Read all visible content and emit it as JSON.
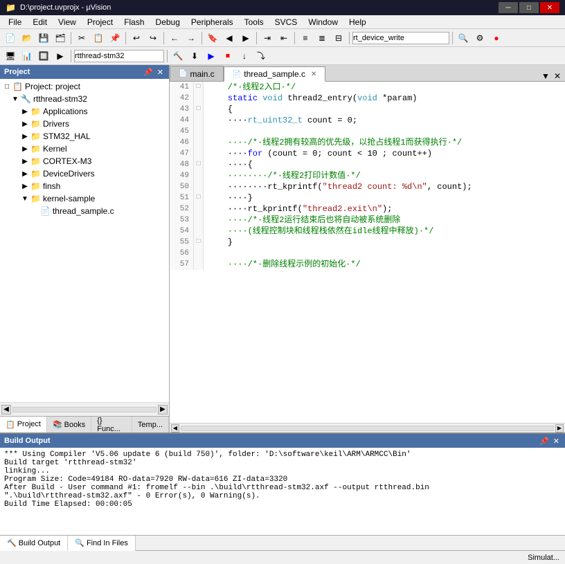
{
  "titleBar": {
    "title": "D:\\project.uvprojx - µVision",
    "icon": "📁",
    "controls": [
      "─",
      "□",
      "✕"
    ]
  },
  "menuBar": {
    "items": [
      "File",
      "Edit",
      "View",
      "Project",
      "Flash",
      "Debug",
      "Peripherals",
      "Tools",
      "SVCS",
      "Window",
      "Help"
    ]
  },
  "toolbar1": {
    "combo_value": "rt_device_write"
  },
  "toolbar2": {
    "combo_value": "rtthread-stm32"
  },
  "leftPanel": {
    "title": "Project",
    "tree": {
      "root": "Project: project",
      "items": [
        {
          "label": "rtthread-stm32",
          "indent": 1,
          "expanded": true,
          "type": "root"
        },
        {
          "label": "Applications",
          "indent": 2,
          "expanded": true,
          "type": "folder"
        },
        {
          "label": "Drivers",
          "indent": 2,
          "expanded": true,
          "type": "folder"
        },
        {
          "label": "STM32_HAL",
          "indent": 2,
          "expanded": true,
          "type": "folder"
        },
        {
          "label": "Kernel",
          "indent": 2,
          "expanded": true,
          "type": "folder"
        },
        {
          "label": "CORTEX-M3",
          "indent": 2,
          "expanded": true,
          "type": "folder"
        },
        {
          "label": "DeviceDrivers",
          "indent": 2,
          "expanded": true,
          "type": "folder"
        },
        {
          "label": "finsh",
          "indent": 2,
          "expanded": true,
          "type": "folder"
        },
        {
          "label": "kernel-sample",
          "indent": 2,
          "expanded": true,
          "type": "folder"
        },
        {
          "label": "thread_sample.c",
          "indent": 3,
          "expanded": false,
          "type": "file"
        }
      ]
    },
    "tabs": [
      {
        "label": "Project",
        "icon": "📋",
        "active": true
      },
      {
        "label": "Books",
        "icon": "📚",
        "active": false
      },
      {
        "label": "{} Func...",
        "icon": "",
        "active": false
      },
      {
        "label": "Temp...",
        "icon": "",
        "active": false
      }
    ]
  },
  "editorTabs": [
    {
      "label": "main.c",
      "icon": "📄",
      "active": false
    },
    {
      "label": "thread_sample.c",
      "icon": "📄",
      "active": true
    }
  ],
  "codeLines": [
    {
      "num": "41",
      "toggle": "□",
      "content": "    /*·线程2入口·*/",
      "type": "comment"
    },
    {
      "num": "42",
      "toggle": " ",
      "content": "    static void thread2_entry(void *param)",
      "type": "code"
    },
    {
      "num": "43",
      "toggle": "□",
      "content": "    {",
      "type": "code"
    },
    {
      "num": "44",
      "toggle": " ",
      "content": "    ····rt_uint32_t count = 0;",
      "type": "code"
    },
    {
      "num": "45",
      "toggle": " ",
      "content": "",
      "type": "code"
    },
    {
      "num": "46",
      "toggle": " ",
      "content": "    ····/*·线程2拥有较高的优先级，以抢占线程1而获得执行·*/",
      "type": "comment"
    },
    {
      "num": "47",
      "toggle": " ",
      "content": "    ····for (count = 0; count < 10 ; count++)",
      "type": "code"
    },
    {
      "num": "48",
      "toggle": "□",
      "content": "    ····{",
      "type": "code"
    },
    {
      "num": "49",
      "toggle": " ",
      "content": "    ········/*·线程2打印计数值·*/",
      "type": "comment"
    },
    {
      "num": "50",
      "toggle": " ",
      "content": "    ········rt_kprintf(\"thread2 count: %d\\n\", count);",
      "type": "code"
    },
    {
      "num": "51",
      "toggle": "□",
      "content": "    ····}",
      "type": "code"
    },
    {
      "num": "52",
      "toggle": " ",
      "content": "    ····rt_kprintf(\"thread2.exit\\n\");",
      "type": "code"
    },
    {
      "num": "53",
      "toggle": " ",
      "content": "    ····/*·线程2运行结束后也将自动被系统删除",
      "type": "comment"
    },
    {
      "num": "54",
      "toggle": " ",
      "content": "    ····(线程控制块和线程栈依然在idle线程中释放)·*/",
      "type": "comment"
    },
    {
      "num": "55",
      "toggle": "□",
      "content": "    }",
      "type": "code"
    },
    {
      "num": "56",
      "toggle": " ",
      "content": "",
      "type": "code"
    },
    {
      "num": "57",
      "toggle": " ",
      "content": "    ····/*·删除线程示例的初始化·*/",
      "type": "comment"
    }
  ],
  "buildOutput": {
    "title": "Build Output",
    "lines": [
      "*** Using Compiler 'V5.06 update 6 (build 750)', folder: 'D:\\software\\keil\\ARM\\ARMCC\\Bin'",
      "Build target 'rtthread-stm32'",
      "linking...",
      "Program Size: Code=49184 RO-data=7920 RW-data=616 ZI-data=3320",
      "After Build - User command #1: fromelf --bin .\\build\\rtthread-stm32.axf --output rtthread.bin",
      "\".\\build\\rtthread-stm32.axf\" - 0 Error(s), 0 Warning(s).",
      "Build Time Elapsed:  00:00:05"
    ],
    "tabs": [
      {
        "label": "Build Output",
        "icon": "🔨",
        "active": true
      },
      {
        "label": "Find In Files",
        "icon": "🔍",
        "active": false
      }
    ]
  },
  "statusBar": {
    "text": "Simulat..."
  }
}
